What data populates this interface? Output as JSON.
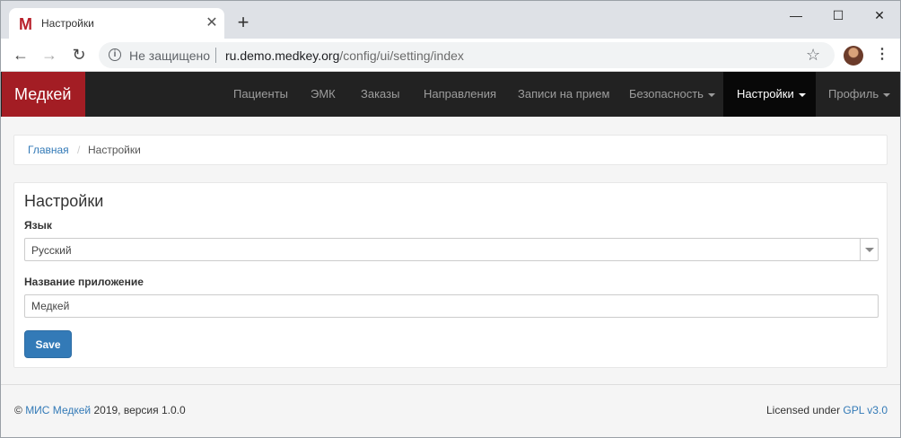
{
  "browser": {
    "tab_favicon": "M",
    "tab_title": "Настройки",
    "tab_close": "✕",
    "new_tab": "+",
    "window_minimize": "—",
    "window_maximize": "☐",
    "window_close": "✕",
    "back": "←",
    "forward": "→",
    "reload": "↻",
    "security_label": "Не защищено",
    "url_host": "ru.demo.medkey.org",
    "url_path": "/config/ui/setting/index",
    "bookmark_star": "☆",
    "menu": "⋮"
  },
  "navbar": {
    "brand": "Медкей",
    "items": [
      {
        "label": "Пациенты"
      },
      {
        "label": "ЭМК"
      },
      {
        "label": "Заказы"
      },
      {
        "label": "Направления"
      },
      {
        "label": "Записи на прием"
      },
      {
        "label": "Безопасность"
      },
      {
        "label": "Настройки"
      },
      {
        "label": "Профиль"
      }
    ],
    "active_color": "#080808",
    "brand_color": "#a31d24"
  },
  "breadcrumb": {
    "home": "Главная",
    "separator": "/",
    "current": "Настройки"
  },
  "settings": {
    "title": "Настройки",
    "language_label": "Язык",
    "language_value": "Русский",
    "app_name_label": "Название приложение",
    "app_name_value": "Медкей",
    "save_label": "Save"
  },
  "footer": {
    "copyright_prefix": "©",
    "product_link": "МИС Медкей",
    "copyright_suffix": "2019, версия 1.0.0",
    "license_prefix": "Licensed under",
    "license_link": "GPL v3.0"
  }
}
